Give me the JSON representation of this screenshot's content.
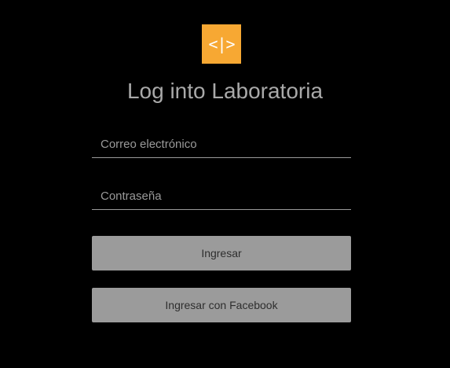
{
  "logo": {
    "glyph": "<|>",
    "color": "#f7a833",
    "icon": "laboratoria-code-icon"
  },
  "title": "Log into Laboratoria",
  "form": {
    "email_placeholder": "Correo electrónico",
    "email_value": "",
    "password_placeholder": "Contraseña",
    "password_value": ""
  },
  "buttons": {
    "login_label": "Ingresar",
    "facebook_label": "Ingresar con Facebook"
  },
  "colors": {
    "background": "#000000",
    "button": "#9b9b9b",
    "title": "#a9a9a9"
  }
}
